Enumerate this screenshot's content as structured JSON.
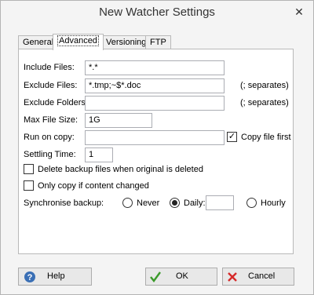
{
  "window": {
    "title": "New Watcher Settings",
    "close_glyph": "✕"
  },
  "tabs": [
    {
      "label": "General",
      "active": false
    },
    {
      "label": "Advanced",
      "active": true
    },
    {
      "label": "Versioning",
      "active": false
    },
    {
      "label": "FTP",
      "active": false
    }
  ],
  "form": {
    "include_files": {
      "label": "Include Files:",
      "value": "*.*"
    },
    "exclude_files": {
      "label": "Exclude Files:",
      "value": "*.tmp;~$*.doc",
      "hint": "(; separates)"
    },
    "exclude_folders": {
      "label": "Exclude Folders:",
      "value": "",
      "hint": "(; separates)"
    },
    "max_file_size": {
      "label": "Max File Size:",
      "value": "1G"
    },
    "run_on_copy": {
      "label": "Run on copy:",
      "value": ""
    },
    "copy_file_first": {
      "label": "Copy file first",
      "checked": true
    },
    "settling_time": {
      "label": "Settling Time:",
      "value": "1"
    },
    "delete_backup": {
      "label": "Delete backup files when original is deleted",
      "checked": false
    },
    "only_copy_changed": {
      "label": "Only copy if content changed",
      "checked": false
    },
    "synchronise_backup": {
      "label": "Synchronise backup:",
      "options": [
        "Never",
        "Daily:",
        "Hourly"
      ],
      "selected": "Daily:",
      "daily_value": ""
    }
  },
  "buttons": {
    "help": "Help",
    "ok": "OK",
    "cancel": "Cancel"
  },
  "icons": {
    "help": "help-icon",
    "ok": "checkmark-icon",
    "cancel": "cross-icon",
    "check_glyph": "✓"
  },
  "colors": {
    "ok_check": "#3a9a2a",
    "cancel_cross": "#d62a2a",
    "help_icon": "#3a6fb5"
  }
}
